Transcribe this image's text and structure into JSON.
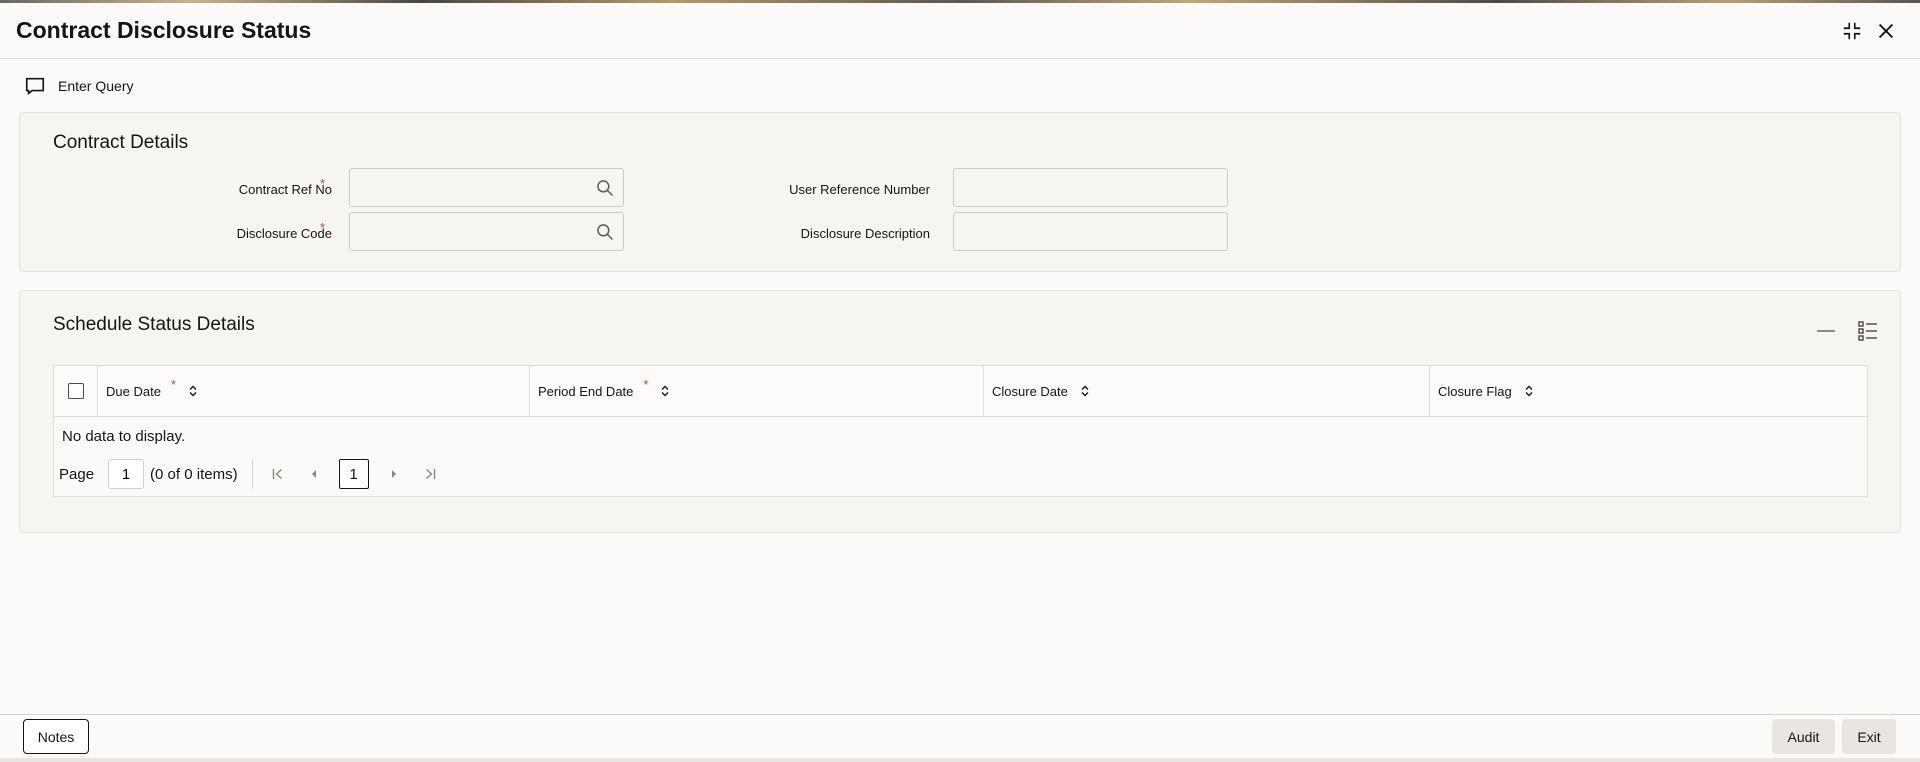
{
  "header": {
    "title": "Contract Disclosure Status",
    "minimize_icon": "compress-icon",
    "close_icon": "close-icon"
  },
  "toolbar": {
    "enter_query_label": "Enter Query",
    "enter_query_icon": "comment-icon"
  },
  "contract_details": {
    "title": "Contract Details",
    "contract_ref_no": {
      "label": "Contract Ref No",
      "required": "*",
      "value": ""
    },
    "disclosure_code": {
      "label": "Disclosure Code",
      "required": "*",
      "value": ""
    },
    "user_reference_number": {
      "label": "User Reference Number",
      "value": ""
    },
    "disclosure_description": {
      "label": "Disclosure Description",
      "value": ""
    }
  },
  "schedule_status": {
    "title": "Schedule Status Details",
    "columns": [
      {
        "label": "Due Date",
        "required": "*"
      },
      {
        "label": "Period End Date",
        "required": "*"
      },
      {
        "label": "Closure Date",
        "required": ""
      },
      {
        "label": "Closure Flag",
        "required": ""
      }
    ],
    "no_data": "No data to display.",
    "pager": {
      "page_label": "Page",
      "page_value": "1",
      "count_text": "(0 of 0 items)",
      "current_page": "1"
    }
  },
  "footer": {
    "notes_label": "Notes",
    "audit_label": "Audit",
    "exit_label": "Exit"
  },
  "colors": {
    "required": "#c74634",
    "text": "#161513",
    "panel_bg": "#f7f5f2"
  }
}
